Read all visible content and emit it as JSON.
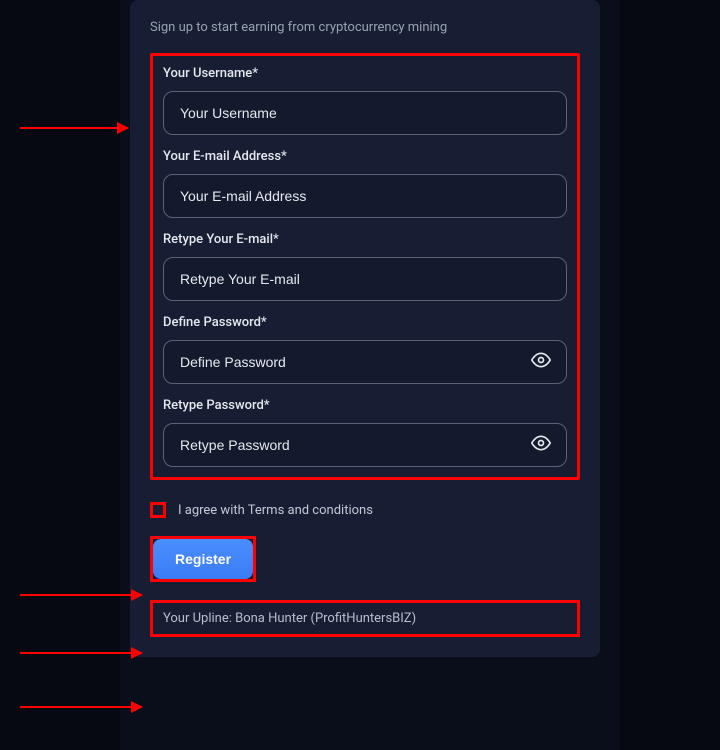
{
  "subtitle": "Sign up to start earning from cryptocurrency mining",
  "fields": {
    "username": {
      "label": "Your Username*",
      "placeholder": "Your Username"
    },
    "email": {
      "label": "Your E-mail Address*",
      "placeholder": "Your E-mail Address"
    },
    "email_retype": {
      "label": "Retype Your E-mail*",
      "placeholder": "Retype Your E-mail"
    },
    "password": {
      "label": "Define Password*",
      "placeholder": "Define Password"
    },
    "password_retype": {
      "label": "Retype Password*",
      "placeholder": "Retype Password"
    }
  },
  "terms": {
    "label": "I agree with Terms and conditions"
  },
  "register_btn": "Register",
  "upline": "Your Upline: Bona Hunter (ProfitHuntersBIZ)"
}
